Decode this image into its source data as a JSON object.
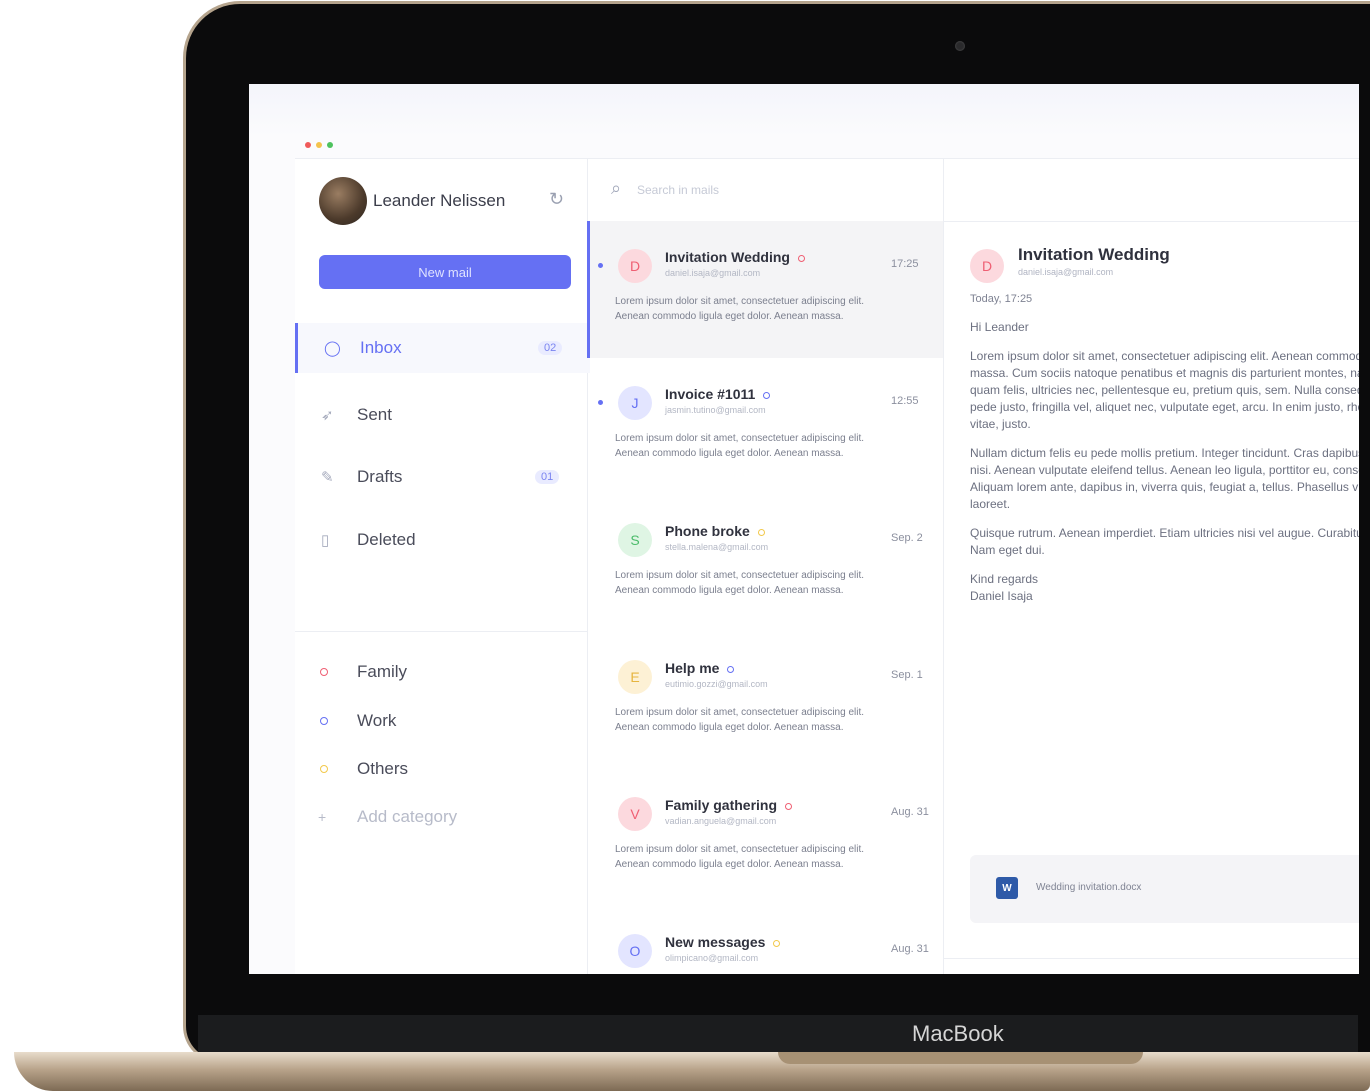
{
  "device": {
    "brand": "MacBook"
  },
  "colors": {
    "accent": "#6570f3",
    "family": "#ef5f73",
    "work": "#6570f3",
    "others": "#f2c94c"
  },
  "sidebar": {
    "user_name": "Leander Nelissen",
    "new_mail_label": "New mail",
    "nav": [
      {
        "label": "Inbox",
        "count": "02",
        "icon": "chat-bubble-icon"
      },
      {
        "label": "Sent",
        "count": "",
        "icon": "paper-plane-icon"
      },
      {
        "label": "Drafts",
        "count": "01",
        "icon": "pencil-icon"
      },
      {
        "label": "Deleted",
        "count": "",
        "icon": "trash-icon"
      }
    ],
    "categories": [
      {
        "label": "Family",
        "color": "#ef5f73"
      },
      {
        "label": "Work",
        "color": "#6570f3"
      },
      {
        "label": "Others",
        "color": "#f2c94c"
      }
    ],
    "add_category_label": "Add category"
  },
  "search": {
    "placeholder": "Search in mails"
  },
  "mails": [
    {
      "initial": "D",
      "subject": "Invitation Wedding",
      "email": "daniel.isaja@gmail.com",
      "time": "17:25",
      "preview": "Lorem ipsum dolor sit amet, consectetuer adipiscing elit. Aenean commodo ligula eget dolor. Aenean massa.",
      "avatar_bg": "#fcd9de",
      "avatar_fg": "#ef5f73",
      "tag_color": "#ef5f73"
    },
    {
      "initial": "J",
      "subject": "Invoice #1011",
      "email": "jasmin.tutino@gmail.com",
      "time": "12:55",
      "preview": "Lorem ipsum dolor sit amet, consectetuer adipiscing elit. Aenean commodo ligula eget dolor. Aenean massa.",
      "avatar_bg": "#e3e5ff",
      "avatar_fg": "#6570f3",
      "tag_color": "#6570f3"
    },
    {
      "initial": "S",
      "subject": "Phone broke",
      "email": "stella.malena@gmail.com",
      "time": "Sep. 2",
      "preview": "Lorem ipsum dolor sit amet, consectetuer adipiscing elit. Aenean commodo ligula eget dolor. Aenean massa.",
      "avatar_bg": "#dff5e4",
      "avatar_fg": "#4cbc6b",
      "tag_color": "#f2c94c"
    },
    {
      "initial": "E",
      "subject": "Help me",
      "email": "eutimio.gozzi@gmail.com",
      "time": "Sep. 1",
      "preview": "Lorem ipsum dolor sit amet, consectetuer adipiscing elit. Aenean commodo ligula eget dolor. Aenean massa.",
      "avatar_bg": "#fdf1d5",
      "avatar_fg": "#e6b53f",
      "tag_color": "#6570f3"
    },
    {
      "initial": "V",
      "subject": "Family gathering",
      "email": "vadian.anguela@gmail.com",
      "time": "Aug. 31",
      "preview": "Lorem ipsum dolor sit amet, consectetuer adipiscing elit. Aenean commodo ligula eget dolor. Aenean massa.",
      "avatar_bg": "#fcd9de",
      "avatar_fg": "#ef5f73",
      "tag_color": "#ef5f73"
    },
    {
      "initial": "O",
      "subject": "New messages",
      "email": "olimpicano@gmail.com",
      "time": "Aug. 31",
      "preview": "Lorem ipsum dolor sit amet, consectetuer adipiscing elit. Aenean commodo ligula eget dolor. Aenean massa.",
      "avatar_bg": "#e3e5ff",
      "avatar_fg": "#6570f3",
      "tag_color": "#f2c94c"
    }
  ],
  "reader": {
    "initial": "D",
    "subject": "Invitation Wedding",
    "email": "daniel.isaja@gmail.com",
    "date": "Today, 17:25",
    "greeting": "Hi Leander",
    "paragraphs": [
      "Lorem ipsum dolor sit amet, consectetuer adipiscing elit. Aenean commodo ligula eget dolor. Aenean massa. Cum sociis natoque penatibus et magnis dis parturient montes, nascetur ridiculus mus. Donec quam felis, ultricies nec, pellentesque eu, pretium quis, sem. Nulla consequat massa quis enim. Donec pede justo, fringilla vel, aliquet nec, vulputate eget, arcu. In enim justo, rhoncus ut, imperdiet a, venenatis vitae, justo.",
      "Nullam dictum felis eu pede mollis pretium. Integer tincidunt. Cras dapibus. Vivamus elementum semper nisi. Aenean vulputate eleifend tellus. Aenean leo ligula, porttitor eu, consequat vitae, eleifend ac, enim. Aliquam lorem ante, dapibus in, viverra quis, feugiat a, tellus. Phasellus viverra nulla ut metus varius laoreet.",
      "Quisque rutrum. Aenean imperdiet. Etiam ultricies nisi vel augue. Curabitur ullamcorper ultricies nisi. Nam eget dui."
    ],
    "signoff": "Kind regards",
    "signature": "Daniel Isaja",
    "attachment": "Wedding invitation.docx"
  }
}
